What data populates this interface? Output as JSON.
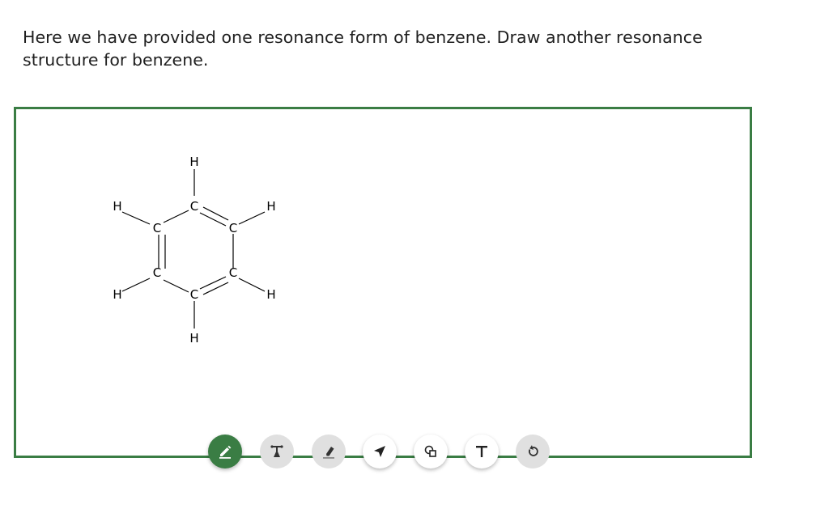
{
  "question": {
    "text": "Here we have provided one resonance form of benzene. Draw another resonance structure for benzene."
  },
  "molecule": {
    "atoms": {
      "carbon": "C",
      "hydrogen": "H"
    }
  },
  "toolbar": {
    "tools": [
      {
        "name": "pen",
        "icon": "pencil-icon",
        "state": "active"
      },
      {
        "name": "bond",
        "icon": "bond-tool-icon",
        "state": "disabled"
      },
      {
        "name": "eraser",
        "icon": "eraser-icon",
        "state": "disabled"
      },
      {
        "name": "select",
        "icon": "arrow-pointer-icon",
        "state": "enabled"
      },
      {
        "name": "shapes",
        "icon": "shapes-icon",
        "state": "enabled"
      },
      {
        "name": "text",
        "icon": "text-icon",
        "state": "enabled"
      },
      {
        "name": "undo",
        "icon": "undo-icon",
        "state": "disabled"
      }
    ]
  },
  "colors": {
    "accent": "#3a7d44",
    "disabled_bg": "#e0e0e0",
    "text": "#1f1f1f"
  }
}
